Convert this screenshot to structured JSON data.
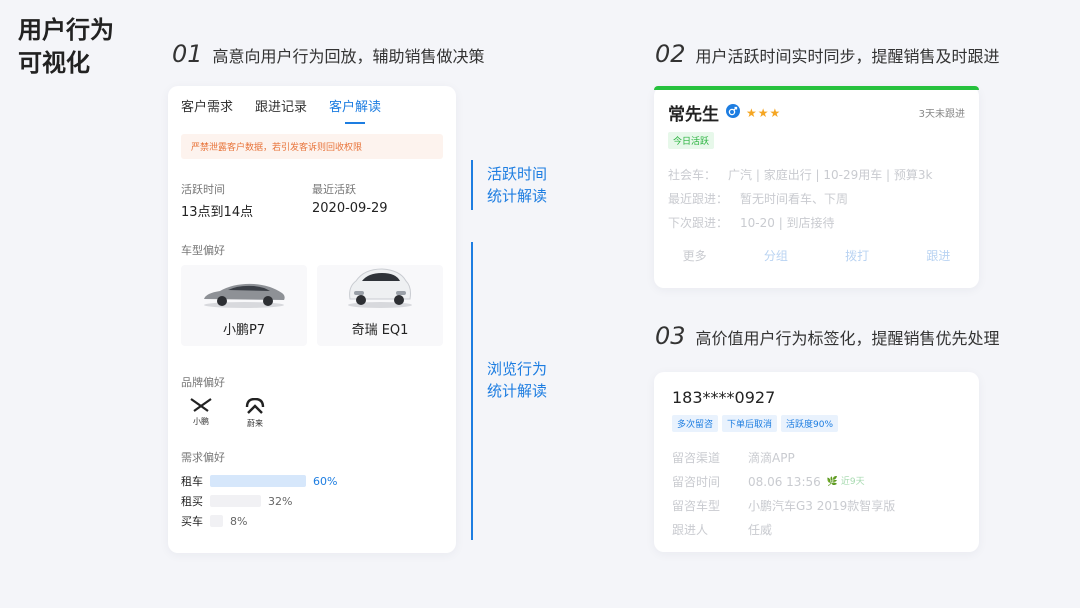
{
  "page_title": "用户行为\n可视化",
  "sections": [
    {
      "num": "01",
      "title": "高意向用户行为回放，辅助销售做决策"
    },
    {
      "num": "02",
      "title": "用户活跃时间实时同步，提醒销售及时跟进"
    },
    {
      "num": "03",
      "title": "高价值用户行为标签化，提醒销售优先处理"
    }
  ],
  "left_card": {
    "tabs": [
      {
        "label": "客户需求",
        "active": false
      },
      {
        "label": "跟进记录",
        "active": false
      },
      {
        "label": "客户解读",
        "active": true
      }
    ],
    "warning": "严禁泄露客户数据，若引发客诉则回收权限",
    "active_time": {
      "label": "活跃时间",
      "value": "13点到14点"
    },
    "last_active": {
      "label": "最近活跃",
      "value": "2020-09-29"
    },
    "car_pref_label": "车型偏好",
    "cars": [
      {
        "name": "小鹏P7",
        "color": "#8e9196"
      },
      {
        "name": "奇瑞 EQ1",
        "color": "#eef0f2"
      }
    ],
    "brand_pref_label": "品牌偏好",
    "brands": [
      {
        "name": "小鹏",
        "icon": "xpeng-logo-icon"
      },
      {
        "name": "蔚来",
        "icon": "nio-logo-icon"
      }
    ],
    "demand_pref_label": "需求偏好",
    "demands": [
      {
        "label": "租车",
        "percent": 60,
        "pct_text": "60%",
        "color": "#d6e7fb",
        "highlight": true
      },
      {
        "label": "租买",
        "percent": 32,
        "pct_text": "32%",
        "color": "#f1f1f4",
        "highlight": false
      },
      {
        "label": "买车",
        "percent": 8,
        "pct_text": "8%",
        "color": "#f1f1f4",
        "highlight": false
      }
    ]
  },
  "middle_labels": [
    {
      "line1": "活跃时间",
      "line2": "统计解读"
    },
    {
      "line1": "浏览行为",
      "line2": "统计解读"
    }
  ],
  "customer_card": {
    "name": "常先生",
    "stars": "★★★",
    "followup_note": "3天未跟进",
    "tag": "今日活跃",
    "rows": [
      {
        "label": "社会车：",
        "value": "广汽 | 家庭出行 | 10-29用车 | 预算3k"
      },
      {
        "label": "最近跟进：",
        "value": "暂无时间看车、下周"
      },
      {
        "label": "下次跟进：",
        "value": "10-20 | 到店接待"
      }
    ],
    "actions": [
      {
        "label": "更多",
        "primary": false
      },
      {
        "label": "分组",
        "primary": true
      },
      {
        "label": "拨打",
        "primary": true
      },
      {
        "label": "跟进",
        "primary": true
      }
    ]
  },
  "lead_card": {
    "phone": "183****0927",
    "tags": [
      "多次留咨",
      "下单后取消",
      "活跃度90%"
    ],
    "rows": [
      {
        "label": "留咨渠道",
        "value": "滴滴APP"
      },
      {
        "label": "留咨时间",
        "value": "08.06 13:56",
        "extra": "近9天"
      },
      {
        "label": "留咨车型",
        "value": "小鹏汽车G3 2019款智享版"
      },
      {
        "label": "跟进人",
        "value": "任威"
      }
    ]
  },
  "colors": {
    "accent": "#1d7de1",
    "active_green": "#26c13d",
    "warning_orange": "#e8743b",
    "star": "#f5a623"
  }
}
